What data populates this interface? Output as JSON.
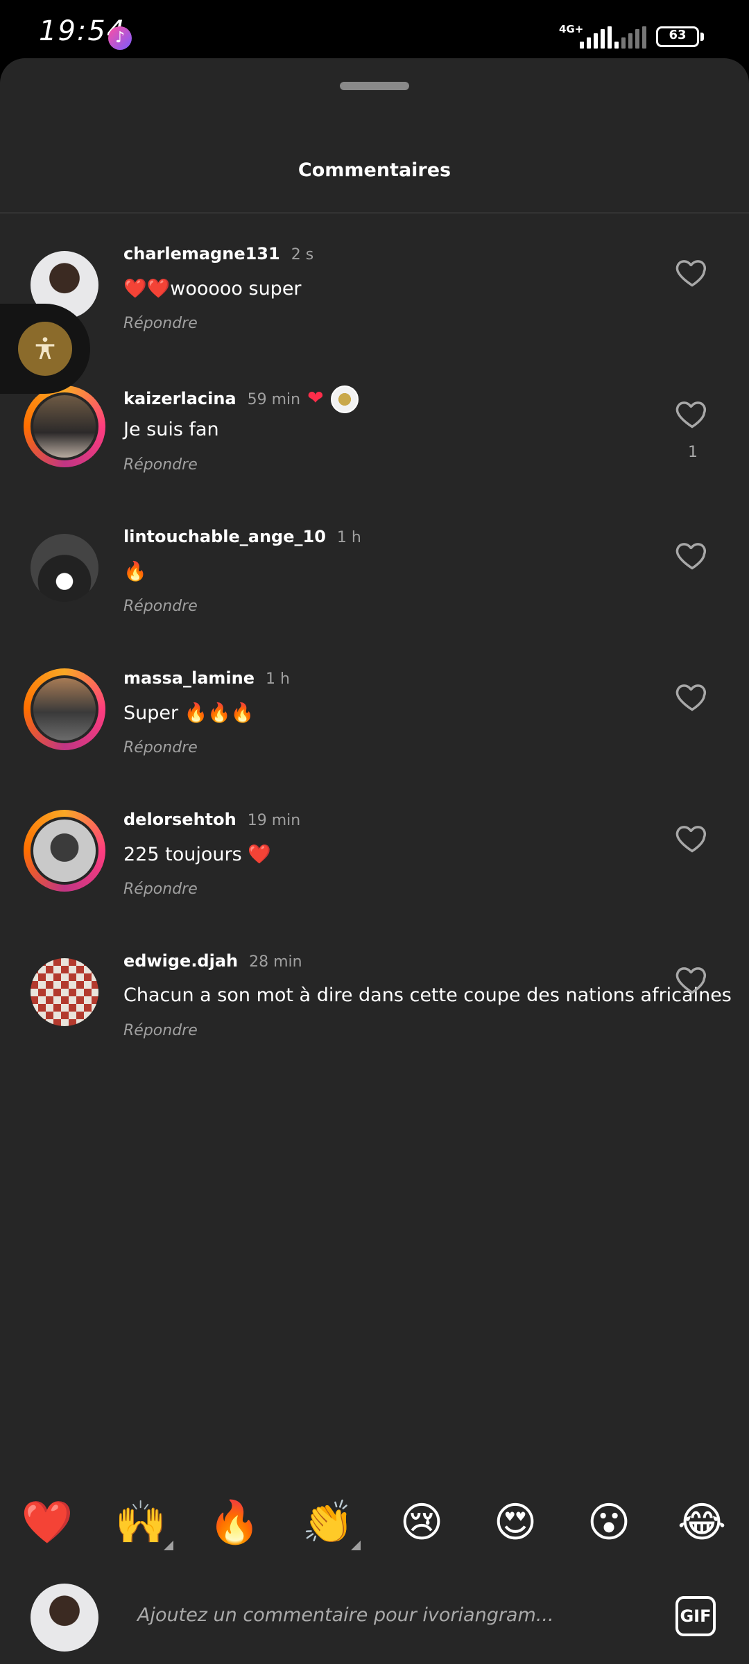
{
  "status_bar": {
    "time": "19:54",
    "network": "4G+",
    "battery": "63"
  },
  "sheet": {
    "title": "Commentaires"
  },
  "comments": [
    {
      "username": "charlemagne131",
      "time": "2 s",
      "text": "❤️❤️wooooo super",
      "reply": "Répondre",
      "likes": ""
    },
    {
      "username": "kaizerlacina",
      "time": "59 min",
      "text": "Je suis fan",
      "reply": "Répondre",
      "likes": "1",
      "creator_heart": "❤"
    },
    {
      "username": "lintouchable_ange_10",
      "time": "1 h",
      "text": "🔥",
      "reply": "Répondre",
      "likes": ""
    },
    {
      "username": "massa_lamine",
      "time": "1 h",
      "text": "Super 🔥🔥🔥",
      "reply": "Répondre",
      "likes": ""
    },
    {
      "username": "delorsehtoh",
      "time": "19 min",
      "text": "225 toujours ❤️",
      "reply": "Répondre",
      "likes": ""
    },
    {
      "username": "edwige.djah",
      "time": "28 min",
      "text": "Chacun a son mot à dire dans cette coupe des nations africaines",
      "reply": "Répondre",
      "likes": ""
    }
  ],
  "quick_reactions": [
    "❤️",
    "🙌",
    "🔥",
    "👏",
    "😢",
    "😍",
    "😮",
    "😂"
  ],
  "composer": {
    "placeholder": "Ajoutez un commentaire pour ivoriangram...",
    "gif_label": "GIF"
  },
  "icons": {
    "like": "heart-outline-icon",
    "accessibility": "accessibility-icon",
    "music": "music-note-icon"
  },
  "colors": {
    "sheet_bg": "#262626",
    "liked_red": "#ff2d4a",
    "muted_text": "#a0a0a0"
  }
}
